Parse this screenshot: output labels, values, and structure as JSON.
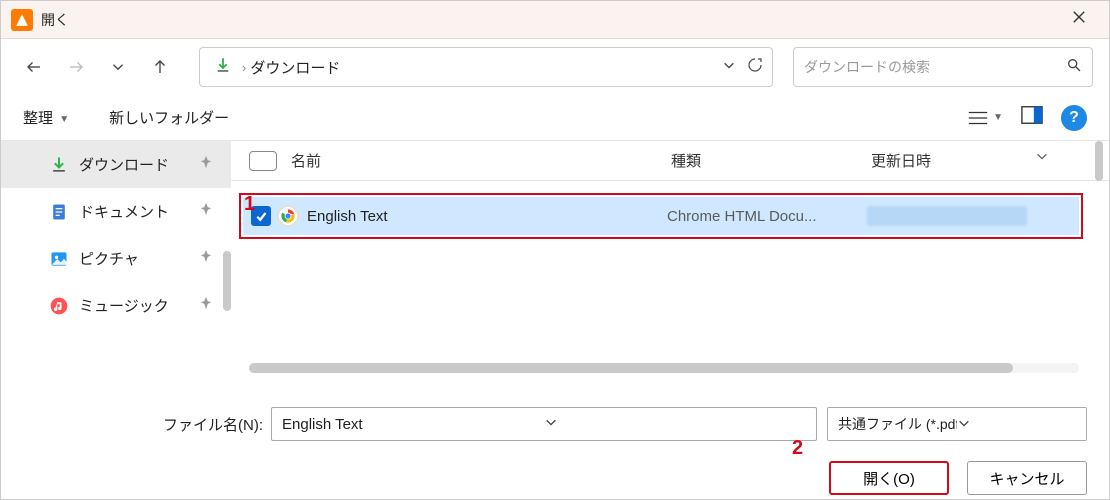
{
  "window": {
    "title": "開く"
  },
  "address": {
    "crumb": "ダウンロード"
  },
  "search": {
    "placeholder": "ダウンロードの検索"
  },
  "toolbar": {
    "organize": "整理",
    "newfolder": "新しいフォルダー"
  },
  "sidebar": {
    "items": [
      {
        "label": "ダウンロード",
        "icon": "download"
      },
      {
        "label": "ドキュメント",
        "icon": "document"
      },
      {
        "label": "ピクチャ",
        "icon": "picture"
      },
      {
        "label": "ミュージック",
        "icon": "music"
      }
    ]
  },
  "columns": {
    "name": "名前",
    "type": "種類",
    "date": "更新日時"
  },
  "rows": [
    {
      "name": "English Text",
      "type": "Chrome HTML Docu..."
    }
  ],
  "annotations": {
    "a1": "1",
    "a2": "2"
  },
  "filename": {
    "label": "ファイル名(N):",
    "value": "English Text"
  },
  "filter": {
    "value": "共通ファイル (*.pdf *.fdf *.xfdf *.x"
  },
  "buttons": {
    "open": "開く(O)",
    "cancel": "キャンセル"
  }
}
